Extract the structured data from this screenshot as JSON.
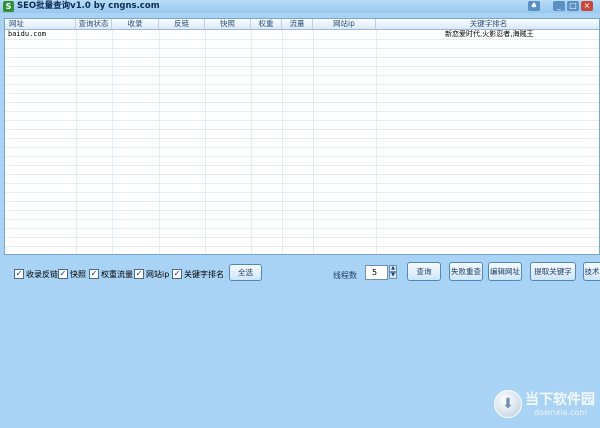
{
  "window": {
    "title": "SEO批量查询v1.0 by cngns.com",
    "colors": {
      "background": "#a9d3f4",
      "grid_bg": "#ffffff",
      "header": "#d8e8f7",
      "accent": "#2f8f3a"
    }
  },
  "grid": {
    "columns": [
      "网址",
      "查询状态",
      "收录",
      "反链",
      "快照",
      "权重",
      "流量",
      "网站ip",
      "关键字排名"
    ],
    "rows": [
      {
        "url": "baidu.com",
        "status": "",
        "index": "",
        "backlinks": "",
        "snapshot": "",
        "weight": "",
        "traffic": "",
        "ip": "",
        "keywords": "新恋爱时代,火影忍者,海贼王"
      }
    ]
  },
  "options": {
    "checkboxes": [
      {
        "label": "收录反链",
        "checked": true
      },
      {
        "label": "快照",
        "checked": true
      },
      {
        "label": "权重流量",
        "checked": true
      },
      {
        "label": "网站ip",
        "checked": true
      },
      {
        "label": "关键字排名",
        "checked": true
      }
    ],
    "select_all": "全选",
    "threads_label": "线程数",
    "threads_value": "5"
  },
  "actions": {
    "query": "查询",
    "retry_failed": "失败重查",
    "edit_urls": "编辑网址",
    "extract_keywords": "提取关键字",
    "tech": "技术"
  },
  "watermark": {
    "name": "当下软件园",
    "domain": "downxia.com",
    "icon": "download-arrow-icon"
  }
}
